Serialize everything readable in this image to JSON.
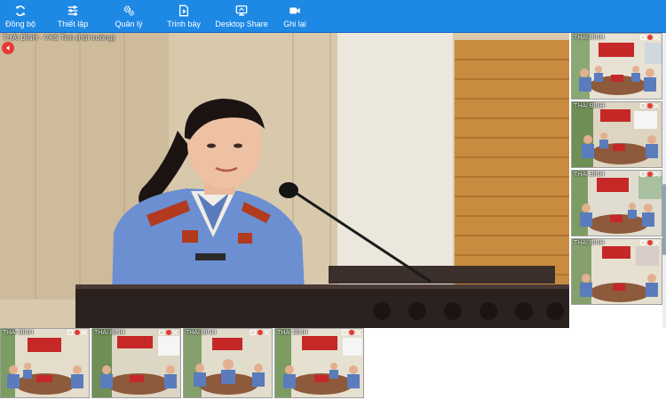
{
  "toolbar": {
    "buttons": [
      {
        "label": "Đồng bộ",
        "icon": "sync-icon"
      },
      {
        "label": "Thiết lập",
        "icon": "sliders-icon"
      },
      {
        "label": "Quản lý",
        "icon": "gears-icon"
      },
      {
        "label": "Trình bày",
        "icon": "present-icon"
      },
      {
        "label": "Desktop Share",
        "icon": "monitor-icon"
      },
      {
        "label": "Ghi lại",
        "icon": "video-camera-icon"
      }
    ]
  },
  "main": {
    "caption": "THÁI BÌNH - VKS Tỉnh (Hội trường)",
    "back_icon": "arrow-left-icon"
  },
  "thumbnails_right": [
    {
      "label": "THÁI BÌNH"
    },
    {
      "label": "THÁI BÌNH"
    },
    {
      "label": "THÁI BÌNH"
    },
    {
      "label": "THÁI BÌNH"
    }
  ],
  "thumbnails_bottom": [
    {
      "label": "THÁI BÌNH"
    },
    {
      "label": "THÁI BÌNH"
    },
    {
      "label": "THÁI BÌNH"
    },
    {
      "label": "THÁI BÌNH"
    }
  ],
  "colors": {
    "toolbar": "#1e88e5",
    "uniform": "#6c8fd1",
    "banner": "#c62828"
  }
}
